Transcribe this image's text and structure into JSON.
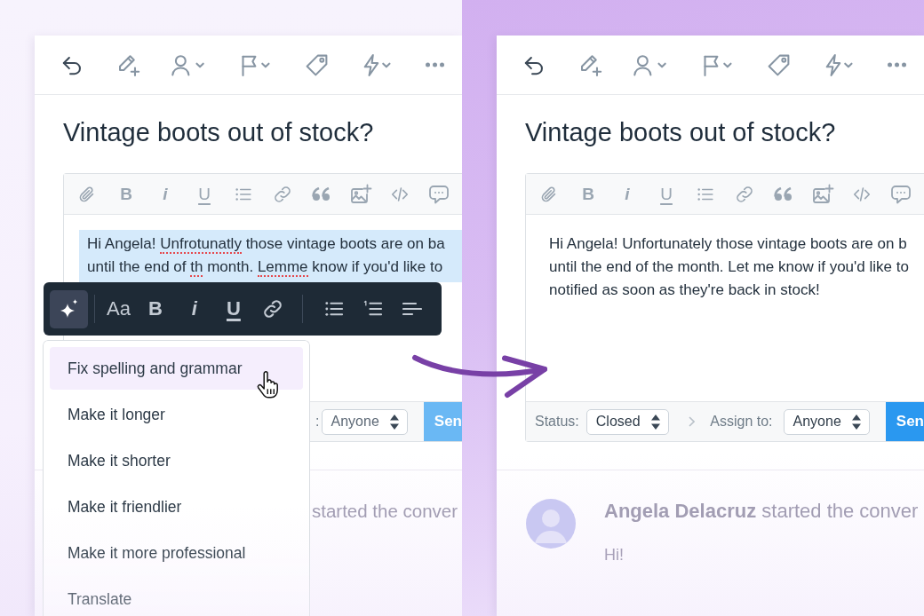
{
  "panels": [
    {
      "title": "Vintage boots out of stock?",
      "editor_toolbar": {
        "bold": "B",
        "italic": "i",
        "underline": "U"
      },
      "message": {
        "selected": true,
        "lines": [
          {
            "segments": [
              {
                "text": "Hi Angela! ",
                "misspelled": false
              },
              {
                "text": "Unfrotunatly",
                "misspelled": true
              },
              {
                "text": " those vintage boots are on ba",
                "misspelled": false
              }
            ]
          },
          {
            "segments": [
              {
                "text": "until the end of ",
                "misspelled": false
              },
              {
                "text": "th",
                "misspelled": true
              },
              {
                "text": " month. ",
                "misspelled": false
              },
              {
                "text": "Lemme",
                "misspelled": true
              },
              {
                "text": " know if you'd like to",
                "misspelled": false
              }
            ]
          }
        ]
      },
      "format_toolbar": {
        "ai_selected": true,
        "text_style": "Aa",
        "bold": "B",
        "italic": "i",
        "underline": "U"
      },
      "ai_menu": [
        {
          "label": "Fix spelling and grammar",
          "selected": true
        },
        {
          "label": "Make it longer",
          "selected": false
        },
        {
          "label": "Make it shorter",
          "selected": false
        },
        {
          "label": "Make it friendlier",
          "selected": false
        },
        {
          "label": "Make it more professional",
          "selected": false
        },
        {
          "label": "Translate",
          "selected": false
        }
      ],
      "footer": {
        "assign_label": ":",
        "assign_value": "Anyone",
        "send_label": "Sen"
      },
      "activity": {
        "text": "started the conver"
      }
    },
    {
      "title": "Vintage boots out of stock?",
      "editor_toolbar": {
        "bold": "B",
        "italic": "i",
        "underline": "U"
      },
      "message": {
        "selected": false,
        "lines": [
          {
            "segments": [
              {
                "text": "Hi Angela! Unfortunately those vintage boots are on b",
                "misspelled": false
              }
            ]
          },
          {
            "segments": [
              {
                "text": "until the end of the month. Let me know if you'd like to",
                "misspelled": false
              }
            ]
          },
          {
            "segments": [
              {
                "text": "notified as soon as they're back in stock!",
                "misspelled": false
              }
            ]
          }
        ]
      },
      "footer": {
        "status_label": "Status:",
        "status_value": "Closed",
        "assign_label": "Assign to:",
        "assign_value": "Anyone",
        "send_label": "Sen"
      },
      "activity": {
        "text": "**Angela Delacruz** started the conver",
        "message": "Hi!"
      }
    }
  ]
}
